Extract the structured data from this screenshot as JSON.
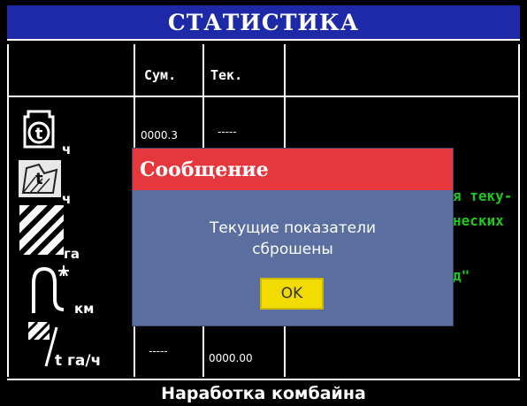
{
  "header": {
    "title": "СТАТИСТИКА"
  },
  "columns": {
    "total": "Сум.",
    "current": "Тек."
  },
  "rows": [
    {
      "icon": "engine-hours-icon",
      "unit": "ч",
      "total": "0000.3",
      "current": "-----"
    },
    {
      "icon": "field-work-hours-icon",
      "unit": "ч",
      "total": "",
      "current": ""
    },
    {
      "icon": "area-hatch-icon",
      "unit": "га",
      "total": "",
      "current": ""
    },
    {
      "icon": "distance-road-icon",
      "unit": "км",
      "total": "",
      "current": ""
    },
    {
      "icon": "productivity-icon",
      "unit": "t га/ч",
      "total": "-----",
      "current": "0000.00"
    }
  ],
  "background_text": {
    "line1": "я теку-",
    "line2": "неских",
    "line3": "д\""
  },
  "footer": {
    "label": "Наработка комбайна"
  },
  "dialog": {
    "title": "Сообщение",
    "message_line1": "Текущие показатели",
    "message_line2": "сброшены",
    "ok_label": "OK"
  },
  "colors": {
    "title_bar": "#1e29a8",
    "dialog_header": "#e6373d",
    "dialog_body": "#5b6ea0",
    "ok_button": "#f2dc00",
    "background_text": "#1ec81e"
  }
}
